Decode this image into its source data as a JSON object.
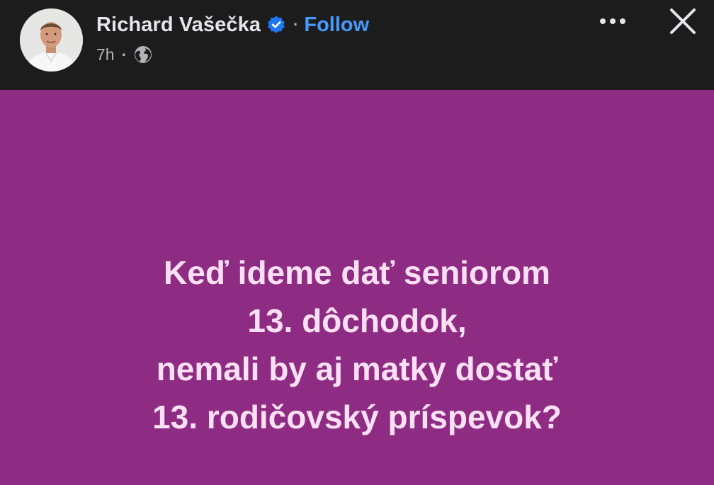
{
  "post": {
    "author_name": "Richard Vašečka",
    "verified_icon": "verified-badge-icon",
    "separator": "·",
    "follow_label": "Follow",
    "time": "7h",
    "meta_separator": "·",
    "audience_icon": "globe-icon",
    "text_lines": [
      "Keď ideme dať seniorom",
      "13. dôchodok,",
      "nemali by aj matky dostať",
      "13. rodičovský príspevok?"
    ],
    "background_color": "#8e2c84",
    "text_color": "#fde0f4"
  },
  "header": {
    "more_icon": "more-options-icon",
    "close_icon": "close-icon",
    "background_color": "#1c1c1c",
    "follow_color": "#4599ff"
  }
}
